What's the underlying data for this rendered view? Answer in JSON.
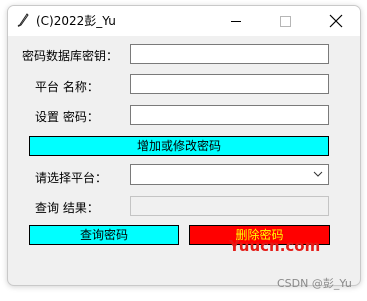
{
  "window": {
    "title": "(C)2022彭_Yu",
    "app_icon": "feather-icon"
  },
  "form": {
    "db_password_label": "密码数据库密钥：",
    "db_password_value": "",
    "platform_name_label": "平台  名称：",
    "platform_name_value": "",
    "set_password_label": "设置  密码：",
    "set_password_value": "",
    "add_modify_button": "增加或修改密码",
    "choose_platform_label": "请选择平台：",
    "choose_platform_value": "",
    "query_result_label": "查询  结果：",
    "query_result_value": "",
    "query_button": "查询密码",
    "delete_button": "删除密码"
  },
  "colors": {
    "cyan_button": "#00ffff",
    "red_button": "#ff0000",
    "red_button_text": "#ffff00"
  },
  "watermarks": {
    "site": "Yuucn.com",
    "csdn": "CSDN @彭_Yu"
  }
}
